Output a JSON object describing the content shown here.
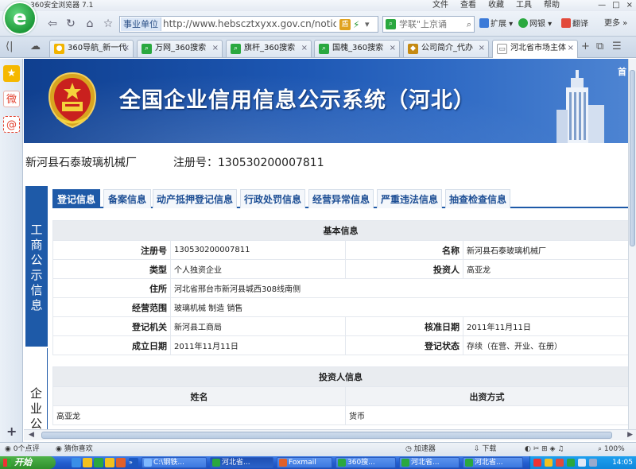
{
  "browser": {
    "app_title": "360安全浏览器 7.1",
    "menus": [
      "文件",
      "查看",
      "收藏",
      "工具",
      "帮助"
    ],
    "window_controls": [
      "—",
      "□",
      "×"
    ],
    "site_tag": "事业单位",
    "url": "http://www.hebscztxyxx.gov.cn/noticehb/r",
    "search_placeholder": "学联\"上京诵",
    "toolbar": {
      "extend": "扩展",
      "netbank": "网银",
      "translate": "翻译",
      "more": "更多"
    },
    "tabs": [
      {
        "label": "360导航_新一代",
        "icon_color": "#f2b400"
      },
      {
        "label": "万网_360搜索",
        "icon_color": "#2aa83f"
      },
      {
        "label": "旗杆_360搜索",
        "icon_color": "#2aa83f"
      },
      {
        "label": "国槐_360搜索",
        "icon_color": "#2aa83f"
      },
      {
        "label": "公司简介_代办",
        "icon_color": "#c58a12"
      },
      {
        "label": "河北省市场主体",
        "icon_color": "#ffffff",
        "active": true
      }
    ]
  },
  "page": {
    "banner_title": "全国企业信用信息公示系统（河北）",
    "banner_home": "首",
    "company_name": "新河县石泰玻璃机械厂",
    "reg_label": "注册号：",
    "reg_number": "130530200007811",
    "vertical_tabs": {
      "active": [
        "工",
        "商",
        "公",
        "示",
        "信",
        "息"
      ],
      "inactive": [
        "企",
        "业",
        "公"
      ]
    },
    "tabs": [
      "登记信息",
      "备案信息",
      "动产抵押登记信息",
      "行政处罚信息",
      "经营异常信息",
      "严重违法信息",
      "抽查检查信息"
    ],
    "basic_info": {
      "header": "基本信息",
      "rows": [
        {
          "l1": "注册号",
          "v1": "130530200007811",
          "l2": "名称",
          "v2": "新河县石泰玻璃机械厂"
        },
        {
          "l1": "类型",
          "v1": "个人独资企业",
          "l2": "投资人",
          "v2": "高亚龙"
        },
        {
          "l1": "住所",
          "v1": "河北省邢台市新河县城西308线南侧"
        },
        {
          "l1": "经营范围",
          "v1": "玻璃机械  制造  销售"
        },
        {
          "l1": "登记机关",
          "v1": "新河县工商局",
          "l2": "核准日期",
          "v2": "2011年11月11日"
        },
        {
          "l1": "成立日期",
          "v1": "2011年11月11日",
          "l2": "登记状态",
          "v2": "存续（在营、开业、在册）"
        }
      ]
    },
    "investor_info": {
      "header": "投资人信息",
      "columns": [
        "姓名",
        "出资方式"
      ],
      "rows": [
        {
          "name": "高亚龙",
          "method": "货币"
        }
      ]
    }
  },
  "statusbar": {
    "comments": "0个点评",
    "guess": "猜你喜欢",
    "accelerator": "加速器",
    "download": "下载",
    "zoom": "100%"
  },
  "taskbar": {
    "start": "开始",
    "buttons": [
      {
        "label": "C:\\钢铁...",
        "color": "#7fb8ff"
      },
      {
        "label": "河北省...",
        "color": "#2aa83f",
        "active": true
      },
      {
        "label": "Foxmail",
        "color": "#e0602a"
      },
      {
        "label": "360搜...",
        "color": "#2aa83f"
      },
      {
        "label": "河北省...",
        "color": "#2aa83f"
      },
      {
        "label": "河北省...",
        "color": "#2aa83f"
      }
    ],
    "clock": "14:05"
  }
}
